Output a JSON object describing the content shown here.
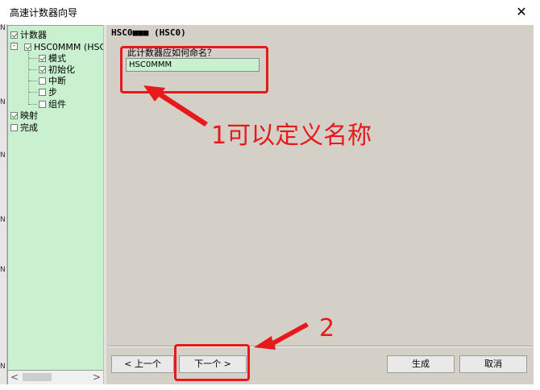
{
  "window": {
    "title": "高速计数器向导",
    "close_glyph": "✕"
  },
  "left_edge_marks": [
    "N",
    "N",
    "N",
    "N",
    "N",
    "N"
  ],
  "tree": {
    "items": [
      {
        "label": "计数器",
        "checked": true
      },
      {
        "label": "HSC0MMM (HSC0",
        "checked": true
      },
      {
        "label": "模式",
        "checked": true
      },
      {
        "label": "初始化",
        "checked": true
      },
      {
        "label": "中断",
        "checked": false
      },
      {
        "label": "步",
        "checked": false
      },
      {
        "label": "组件",
        "checked": false
      },
      {
        "label": "映射",
        "checked": true
      },
      {
        "label": "完成",
        "checked": false
      }
    ],
    "expander": "-"
  },
  "scroll": {
    "left": "<",
    "right": ">"
  },
  "panel": {
    "heading": "HSC0■■■ (HSC0)",
    "question": "此计数器应如何命名？",
    "name_value": "HSC0MMM"
  },
  "buttons": {
    "prev": "< 上一个",
    "next": "下一个 >",
    "generate": "生成",
    "cancel": "取消"
  },
  "annotations": {
    "note1": "1可以定义名称",
    "note2": "2",
    "color": "#e8191b"
  }
}
